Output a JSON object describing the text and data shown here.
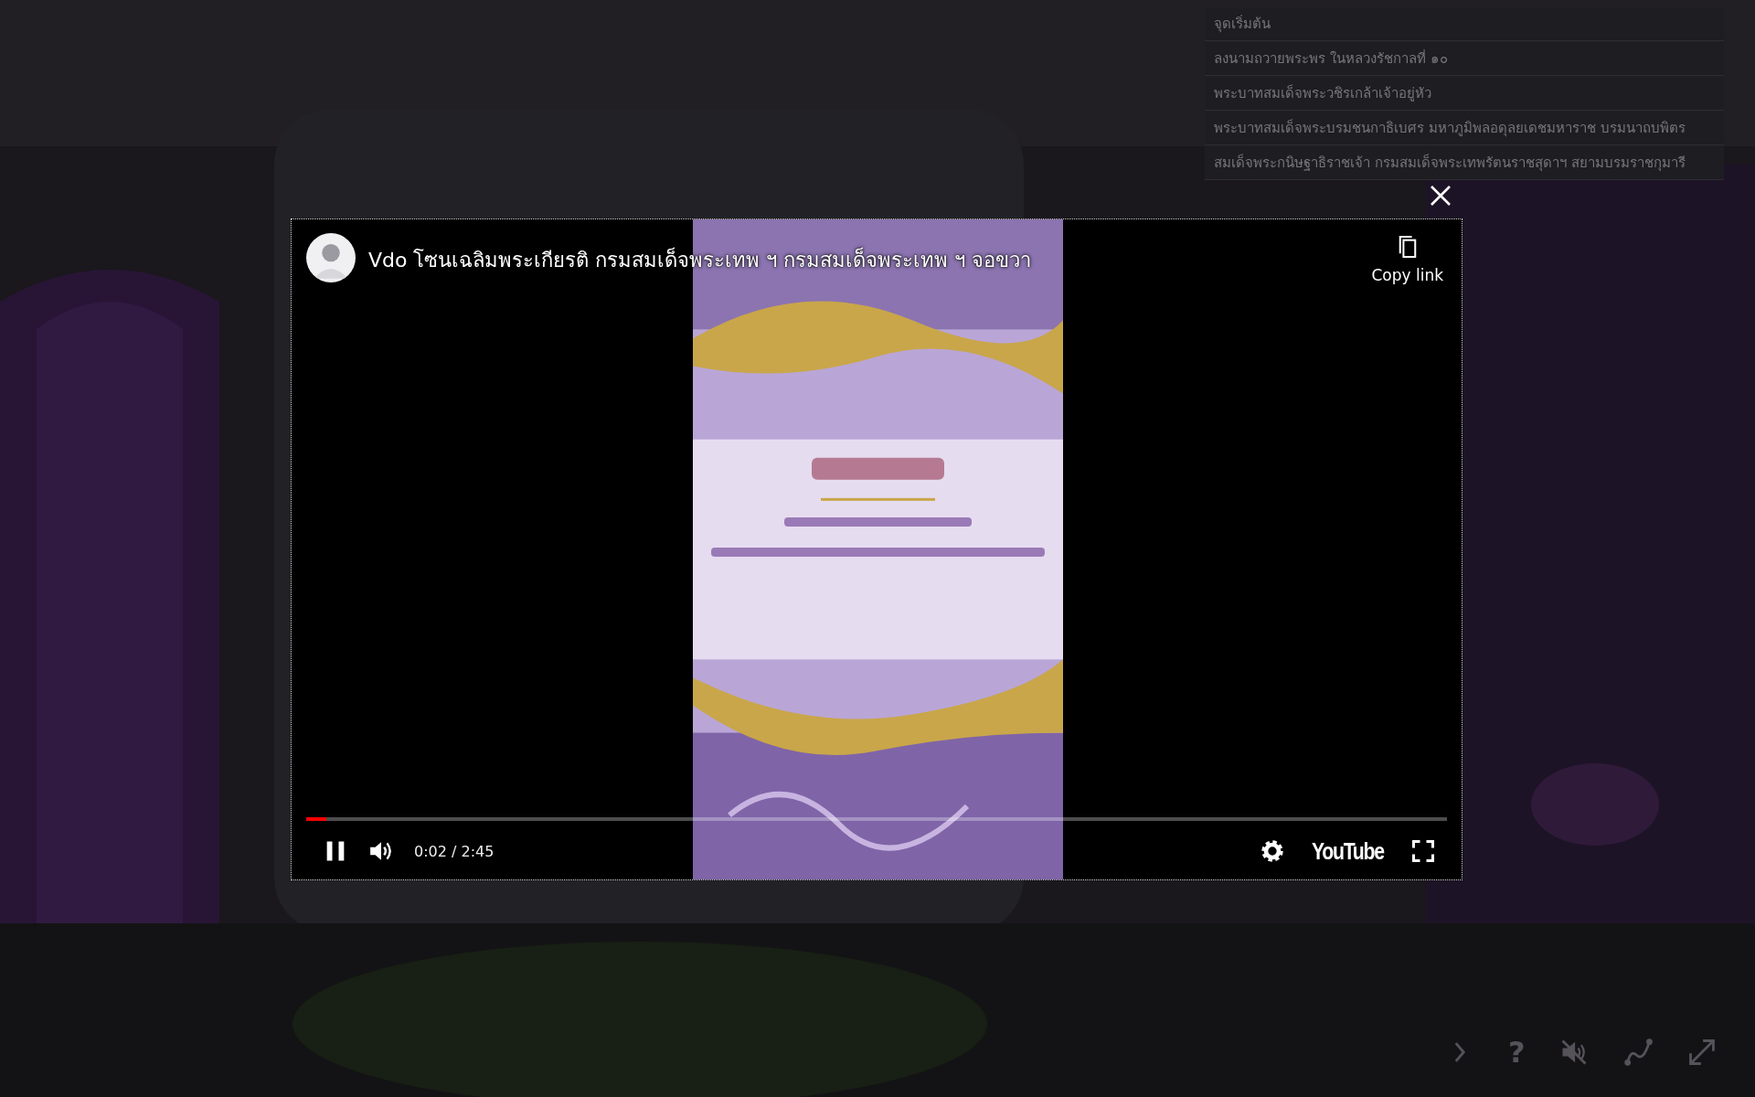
{
  "menu": {
    "items": [
      {
        "label": "จุดเริ่มต้น"
      },
      {
        "label": "ลงนามถวายพระพร ในหลวงรัชกาลที่ ๑๐"
      },
      {
        "label": "พระบาทสมเด็จพระวชิรเกล้าเจ้าอยู่หัว"
      },
      {
        "label": "พระบาทสมเด็จพระบรมชนกาธิเบศร มหาภูมิพลอดุลยเดชมหาราช บรมนาถบพิตร"
      },
      {
        "label": "สมเด็จพระกนิษฐาธิราชเจ้า กรมสมเด็จพระเทพรัตนราชสุดาฯ สยามบรมราชกุมารี"
      }
    ]
  },
  "video": {
    "title": "Vdo โซนเฉลิมพระเกียรติ กรมสมเด็จพระเทพ ฯ กรมสมเด็จพระเทพ ฯ จอขวา",
    "copy_link": "Copy link",
    "progress": {
      "level": 0.018
    },
    "playing": true,
    "muted": false,
    "time": "0:02 / 2:45",
    "brand": "YouTube"
  },
  "scene_controls": {
    "help": "?",
    "sound_muted": true
  }
}
